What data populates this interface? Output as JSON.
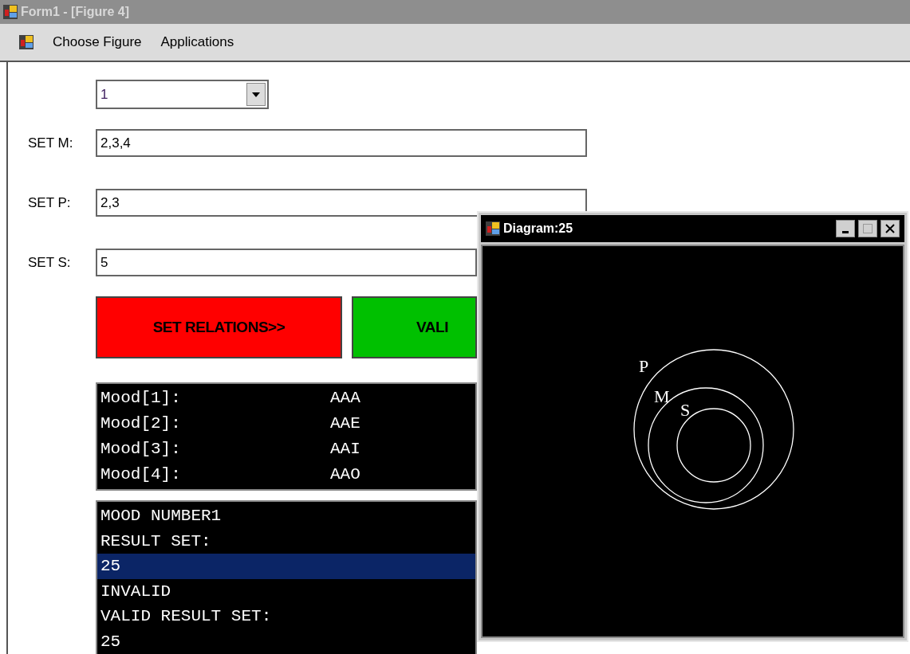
{
  "window": {
    "title": "Form1 - [Figure 4]"
  },
  "menu": [
    {
      "label": "Choose Figure"
    },
    {
      "label": "Applications"
    }
  ],
  "figure_combo": {
    "value": "1"
  },
  "fields": [
    {
      "label": "SET M:",
      "value": "2,3,4"
    },
    {
      "label": "SET P:",
      "value": "2,3"
    },
    {
      "label": "SET S:",
      "value": "5"
    }
  ],
  "buttons": [
    {
      "label": "SET RELATIONS>>",
      "color": "#ff0000"
    },
    {
      "label": "VALI",
      "color": "#00c000"
    }
  ],
  "mood_list": [
    {
      "label": "Mood[1]:",
      "value": "AAA"
    },
    {
      "label": "Mood[2]:",
      "value": "AAE"
    },
    {
      "label": "Mood[3]:",
      "value": "AAI"
    },
    {
      "label": "Mood[4]:",
      "value": "AAO"
    }
  ],
  "result_list": [
    {
      "text": "MOOD NUMBER1",
      "selected": false
    },
    {
      "text": "RESULT SET:",
      "selected": false
    },
    {
      "text": "25",
      "selected": true
    },
    {
      "text": "INVALID",
      "selected": false
    },
    {
      "text": "VALID RESULT SET:",
      "selected": false
    },
    {
      "text": "25",
      "selected": false
    }
  ],
  "diagram_window": {
    "title": "Diagram:25",
    "circle_labels": [
      "P",
      "M",
      "S"
    ]
  }
}
